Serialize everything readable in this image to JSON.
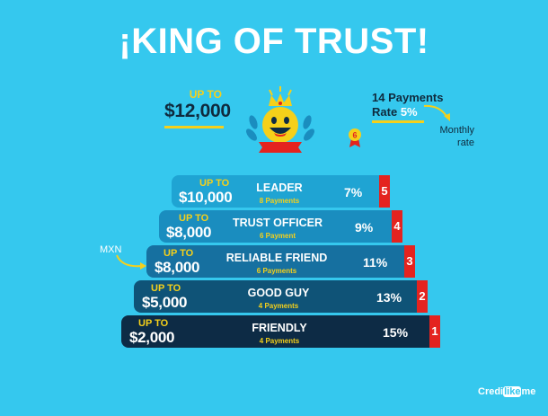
{
  "title": "¡KING OF TRUST!",
  "top": {
    "upto": "UP TO",
    "amount": "$12,000",
    "medal": "6",
    "payments": "14 Payments",
    "rate_label": "Rate",
    "rate_value": "5%",
    "monthly_rate": "Monthly rate"
  },
  "currency_label": "MXN",
  "tiers": [
    {
      "upto": "UP TO",
      "amount": "$10,000",
      "name": "LEADER",
      "payments": "8 Payments",
      "rate": "7%",
      "level": "5"
    },
    {
      "upto": "UP TO",
      "amount": "$8,000",
      "name": "TRUST OFFICER",
      "payments": "6 Payment",
      "rate": "9%",
      "level": "4"
    },
    {
      "upto": "UP TO",
      "amount": "$8,000",
      "name": "RELIABLE FRIEND",
      "payments": "6 Payments",
      "rate": "11%",
      "level": "3"
    },
    {
      "upto": "UP TO",
      "amount": "$5,000",
      "name": "GOOD GUY",
      "payments": "4 Payments",
      "rate": "13%",
      "level": "2"
    },
    {
      "upto": "UP TO",
      "amount": "$2,000",
      "name": "FRIENDLY",
      "payments": "4 Payments",
      "rate": "15%",
      "level": "1"
    }
  ],
  "logo": {
    "pre": "Credi",
    "mid": "like",
    "post": "me"
  },
  "colors": {
    "background": "#35c8ee",
    "tier5": "#1fa4d3",
    "tier4": "#1a8dbf",
    "tier3": "#1670a0",
    "tier2": "#0f5377",
    "tier1": "#0d2b45",
    "accent_yellow": "#f5d01a",
    "level_red": "#e4231f"
  },
  "icons": [
    "crown-badge-icon",
    "smiley-face-icon",
    "medal-icon",
    "curved-arrow-icon"
  ]
}
